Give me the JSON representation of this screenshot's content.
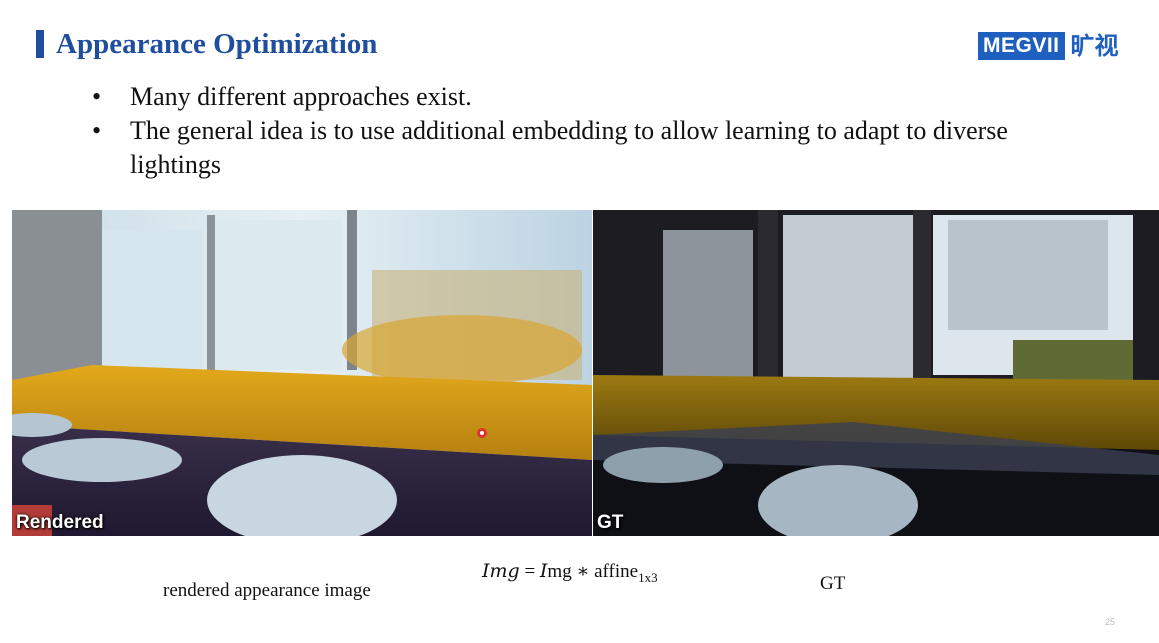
{
  "slide": {
    "title": "Appearance Optimization",
    "logo_text": "MEGVII",
    "logo_cn": "旷视",
    "page_number": "25"
  },
  "bullets": [
    "Many different approaches exist.",
    "The general idea is to use additional embedding to allow learning to adapt to diverse lightings"
  ],
  "images": {
    "left_tag": "Rendered",
    "right_tag": "GT"
  },
  "captions": {
    "left": "rendered appearance image",
    "right": "GT"
  },
  "formula": {
    "lhs": "Img",
    "eq": "=",
    "rhs_var": "I",
    "rhs_rest": "mg",
    "op": "∗",
    "func": "affine",
    "sub": "1x3"
  },
  "colors": {
    "accent": "#1f4e9e",
    "logo": "#1f5fbf"
  }
}
